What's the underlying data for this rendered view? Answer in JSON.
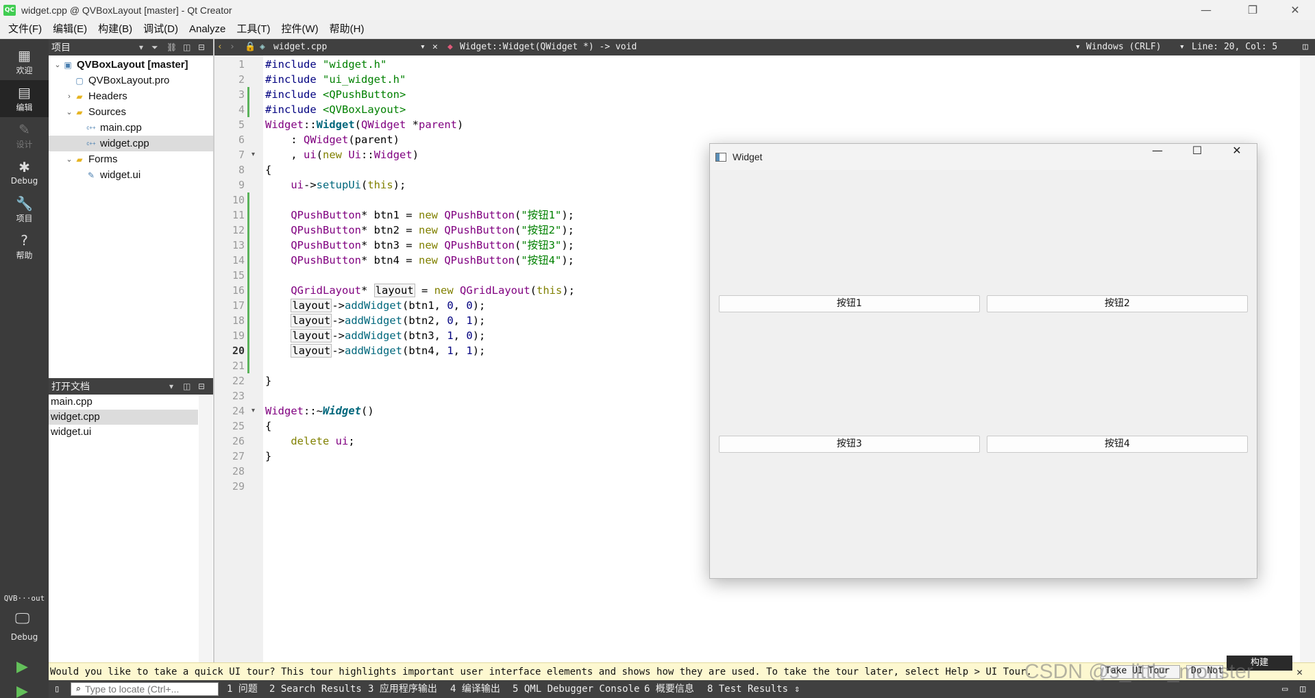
{
  "window": {
    "title": "widget.cpp @ QVBoxLayout [master] - Qt Creator",
    "logo": "QC",
    "controls": {
      "minimize": "—",
      "restore": "❐",
      "close": "✕"
    }
  },
  "menubar": [
    "文件(F)",
    "编辑(E)",
    "构建(B)",
    "调试(D)",
    "Analyze",
    "工具(T)",
    "控件(W)",
    "帮助(H)"
  ],
  "modes": [
    {
      "label": "欢迎",
      "icon": "▦",
      "state": "normal"
    },
    {
      "label": "编辑",
      "icon": "▤",
      "state": "active"
    },
    {
      "label": "设计",
      "icon": "✎",
      "state": "disabled"
    },
    {
      "label": "Debug",
      "icon": "✱",
      "state": "normal"
    },
    {
      "label": "项目",
      "icon": "🔧",
      "state": "normal"
    },
    {
      "label": "帮助",
      "icon": "?",
      "state": "normal"
    }
  ],
  "kit": {
    "label": "QVB···out",
    "mode": "Debug",
    "icon": "🖵"
  },
  "actions": {
    "run": "▶",
    "debug_run": "▶",
    "build": "🔨"
  },
  "project_pane": {
    "title": "项目",
    "tree": [
      {
        "label": "QVBoxLayout [master]",
        "depth": 0,
        "arrow": "⌄",
        "icon": "▣",
        "bold": true
      },
      {
        "label": "QVBoxLayout.pro",
        "depth": 1,
        "arrow": "",
        "icon": "▢"
      },
      {
        "label": "Headers",
        "depth": 1,
        "arrow": "›",
        "icon": "▰"
      },
      {
        "label": "Sources",
        "depth": 1,
        "arrow": "⌄",
        "icon": "▰"
      },
      {
        "label": "main.cpp",
        "depth": 2,
        "arrow": "",
        "icon": "c++"
      },
      {
        "label": "widget.cpp",
        "depth": 2,
        "arrow": "",
        "icon": "c++",
        "selected": true
      },
      {
        "label": "Forms",
        "depth": 1,
        "arrow": "⌄",
        "icon": "▰"
      },
      {
        "label": "widget.ui",
        "depth": 2,
        "arrow": "",
        "icon": "✎"
      }
    ]
  },
  "open_docs": {
    "title": "打开文档",
    "items": [
      {
        "label": "main.cpp"
      },
      {
        "label": "widget.cpp",
        "selected": true
      },
      {
        "label": "widget.ui"
      }
    ]
  },
  "editor_toolbar": {
    "file": "widget.cpp",
    "symbol": "Widget::Widget(QWidget *) -> void",
    "encoding": "Windows (CRLF)",
    "position": "Line: 20, Col: 5"
  },
  "editor": {
    "current_line": 20,
    "changed_lines": [
      3,
      4,
      10,
      11,
      12,
      13,
      14,
      15,
      16,
      17,
      18,
      19,
      20,
      21
    ],
    "fold_lines": [
      7,
      24
    ],
    "lines": [
      [
        {
          "t": "#include ",
          "c": "pp"
        },
        {
          "t": "\"widget.h\"",
          "c": "str"
        }
      ],
      [
        {
          "t": "#include ",
          "c": "pp"
        },
        {
          "t": "\"ui_widget.h\"",
          "c": "str"
        }
      ],
      [
        {
          "t": "#include ",
          "c": "pp"
        },
        {
          "t": "<QPushButton>",
          "c": "str"
        }
      ],
      [
        {
          "t": "#include ",
          "c": "pp"
        },
        {
          "t": "<QVBoxLayout>",
          "c": "str"
        }
      ],
      [
        {
          "t": "Widget",
          "c": "ty"
        },
        {
          "t": "::"
        },
        {
          "t": "Widget",
          "c": "fnb"
        },
        {
          "t": "("
        },
        {
          "t": "QWidget",
          "c": "ty"
        },
        {
          "t": " *"
        },
        {
          "t": "parent",
          "c": "ty"
        },
        {
          "t": ")"
        }
      ],
      [
        {
          "t": "    : "
        },
        {
          "t": "QWidget",
          "c": "ty"
        },
        {
          "t": "(parent)"
        }
      ],
      [
        {
          "t": "    , "
        },
        {
          "t": "ui",
          "c": "ty"
        },
        {
          "t": "("
        },
        {
          "t": "new",
          "c": "kw"
        },
        {
          "t": " "
        },
        {
          "t": "Ui",
          "c": "ty"
        },
        {
          "t": "::"
        },
        {
          "t": "Widget",
          "c": "ty"
        },
        {
          "t": ")"
        }
      ],
      [
        {
          "t": "{"
        }
      ],
      [
        {
          "t": "    "
        },
        {
          "t": "ui",
          "c": "ty"
        },
        {
          "t": "->"
        },
        {
          "t": "setupUi",
          "c": "fn"
        },
        {
          "t": "("
        },
        {
          "t": "this",
          "c": "kw"
        },
        {
          "t": ");"
        }
      ],
      [],
      [
        {
          "t": "    "
        },
        {
          "t": "QPushButton",
          "c": "ty"
        },
        {
          "t": "* btn1 = "
        },
        {
          "t": "new",
          "c": "kw"
        },
        {
          "t": " "
        },
        {
          "t": "QPushButton",
          "c": "ty"
        },
        {
          "t": "("
        },
        {
          "t": "\"按钮1\"",
          "c": "str"
        },
        {
          "t": ");"
        }
      ],
      [
        {
          "t": "    "
        },
        {
          "t": "QPushButton",
          "c": "ty"
        },
        {
          "t": "* btn2 = "
        },
        {
          "t": "new",
          "c": "kw"
        },
        {
          "t": " "
        },
        {
          "t": "QPushButton",
          "c": "ty"
        },
        {
          "t": "("
        },
        {
          "t": "\"按钮2\"",
          "c": "str"
        },
        {
          "t": ");"
        }
      ],
      [
        {
          "t": "    "
        },
        {
          "t": "QPushButton",
          "c": "ty"
        },
        {
          "t": "* btn3 = "
        },
        {
          "t": "new",
          "c": "kw"
        },
        {
          "t": " "
        },
        {
          "t": "QPushButton",
          "c": "ty"
        },
        {
          "t": "("
        },
        {
          "t": "\"按钮3\"",
          "c": "str"
        },
        {
          "t": ");"
        }
      ],
      [
        {
          "t": "    "
        },
        {
          "t": "QPushButton",
          "c": "ty"
        },
        {
          "t": "* btn4 = "
        },
        {
          "t": "new",
          "c": "kw"
        },
        {
          "t": " "
        },
        {
          "t": "QPushButton",
          "c": "ty"
        },
        {
          "t": "("
        },
        {
          "t": "\"按钮4\"",
          "c": "str"
        },
        {
          "t": ");"
        }
      ],
      [],
      [
        {
          "t": "    "
        },
        {
          "t": "QGridLayout",
          "c": "ty"
        },
        {
          "t": "* "
        },
        {
          "t": "layout",
          "c": "hl"
        },
        {
          "t": " = "
        },
        {
          "t": "new",
          "c": "kw"
        },
        {
          "t": " "
        },
        {
          "t": "QGridLayout",
          "c": "ty"
        },
        {
          "t": "("
        },
        {
          "t": "this",
          "c": "kw"
        },
        {
          "t": ");"
        }
      ],
      [
        {
          "t": "    "
        },
        {
          "t": "layout",
          "c": "hl"
        },
        {
          "t": "->"
        },
        {
          "t": "addWidget",
          "c": "fn"
        },
        {
          "t": "(btn1, "
        },
        {
          "t": "0",
          "c": "num"
        },
        {
          "t": ", "
        },
        {
          "t": "0",
          "c": "num"
        },
        {
          "t": ");"
        }
      ],
      [
        {
          "t": "    "
        },
        {
          "t": "layout",
          "c": "hl"
        },
        {
          "t": "->"
        },
        {
          "t": "addWidget",
          "c": "fn"
        },
        {
          "t": "(btn2, "
        },
        {
          "t": "0",
          "c": "num"
        },
        {
          "t": ", "
        },
        {
          "t": "1",
          "c": "num"
        },
        {
          "t": ");"
        }
      ],
      [
        {
          "t": "    "
        },
        {
          "t": "layout",
          "c": "hl"
        },
        {
          "t": "->"
        },
        {
          "t": "addWidget",
          "c": "fn"
        },
        {
          "t": "(btn3, "
        },
        {
          "t": "1",
          "c": "num"
        },
        {
          "t": ", "
        },
        {
          "t": "0",
          "c": "num"
        },
        {
          "t": ");"
        }
      ],
      [
        {
          "t": "    "
        },
        {
          "t": "layout",
          "c": "hl"
        },
        {
          "t": "->"
        },
        {
          "t": "addWidget",
          "c": "fn"
        },
        {
          "t": "(btn4, "
        },
        {
          "t": "1",
          "c": "num"
        },
        {
          "t": ", "
        },
        {
          "t": "1",
          "c": "num"
        },
        {
          "t": ");"
        }
      ],
      [],
      [
        {
          "t": "}"
        }
      ],
      [],
      [
        {
          "t": "Widget",
          "c": "ty"
        },
        {
          "t": "::~"
        },
        {
          "t": "Widget",
          "c": "fni"
        },
        {
          "t": "()"
        }
      ],
      [
        {
          "t": "{"
        }
      ],
      [
        {
          "t": "    "
        },
        {
          "t": "delete",
          "c": "kw"
        },
        {
          "t": " "
        },
        {
          "t": "ui",
          "c": "ty"
        },
        {
          "t": ";"
        }
      ],
      [
        {
          "t": "}"
        }
      ],
      [],
      []
    ]
  },
  "widget_window": {
    "title": "Widget",
    "controls": {
      "minimize": "—",
      "maximize": "☐",
      "close": "✕"
    },
    "buttons": [
      "按钮1",
      "按钮2",
      "按钮3",
      "按钮4"
    ]
  },
  "tour": {
    "message": "Would you like to take a quick UI tour? This tour highlights important user interface elements and shows how they are used. To take the tour later, select Help > UI Tour.",
    "take_label": "Take UI Tour",
    "dont_label": "Do Not Show Again",
    "close": "✕"
  },
  "build_popup": "构建",
  "output_bar": {
    "locator_placeholder": "Type to locate (Ctrl+...",
    "tabs": [
      "1 问题",
      "2 Search Results",
      "3 应用程序输出",
      "4 编译输出",
      "5 QML Debugger Console",
      "6 概要信息",
      "8 Test Results"
    ],
    "more": "⇕"
  },
  "watermark": "CSDN @s_little_monster"
}
